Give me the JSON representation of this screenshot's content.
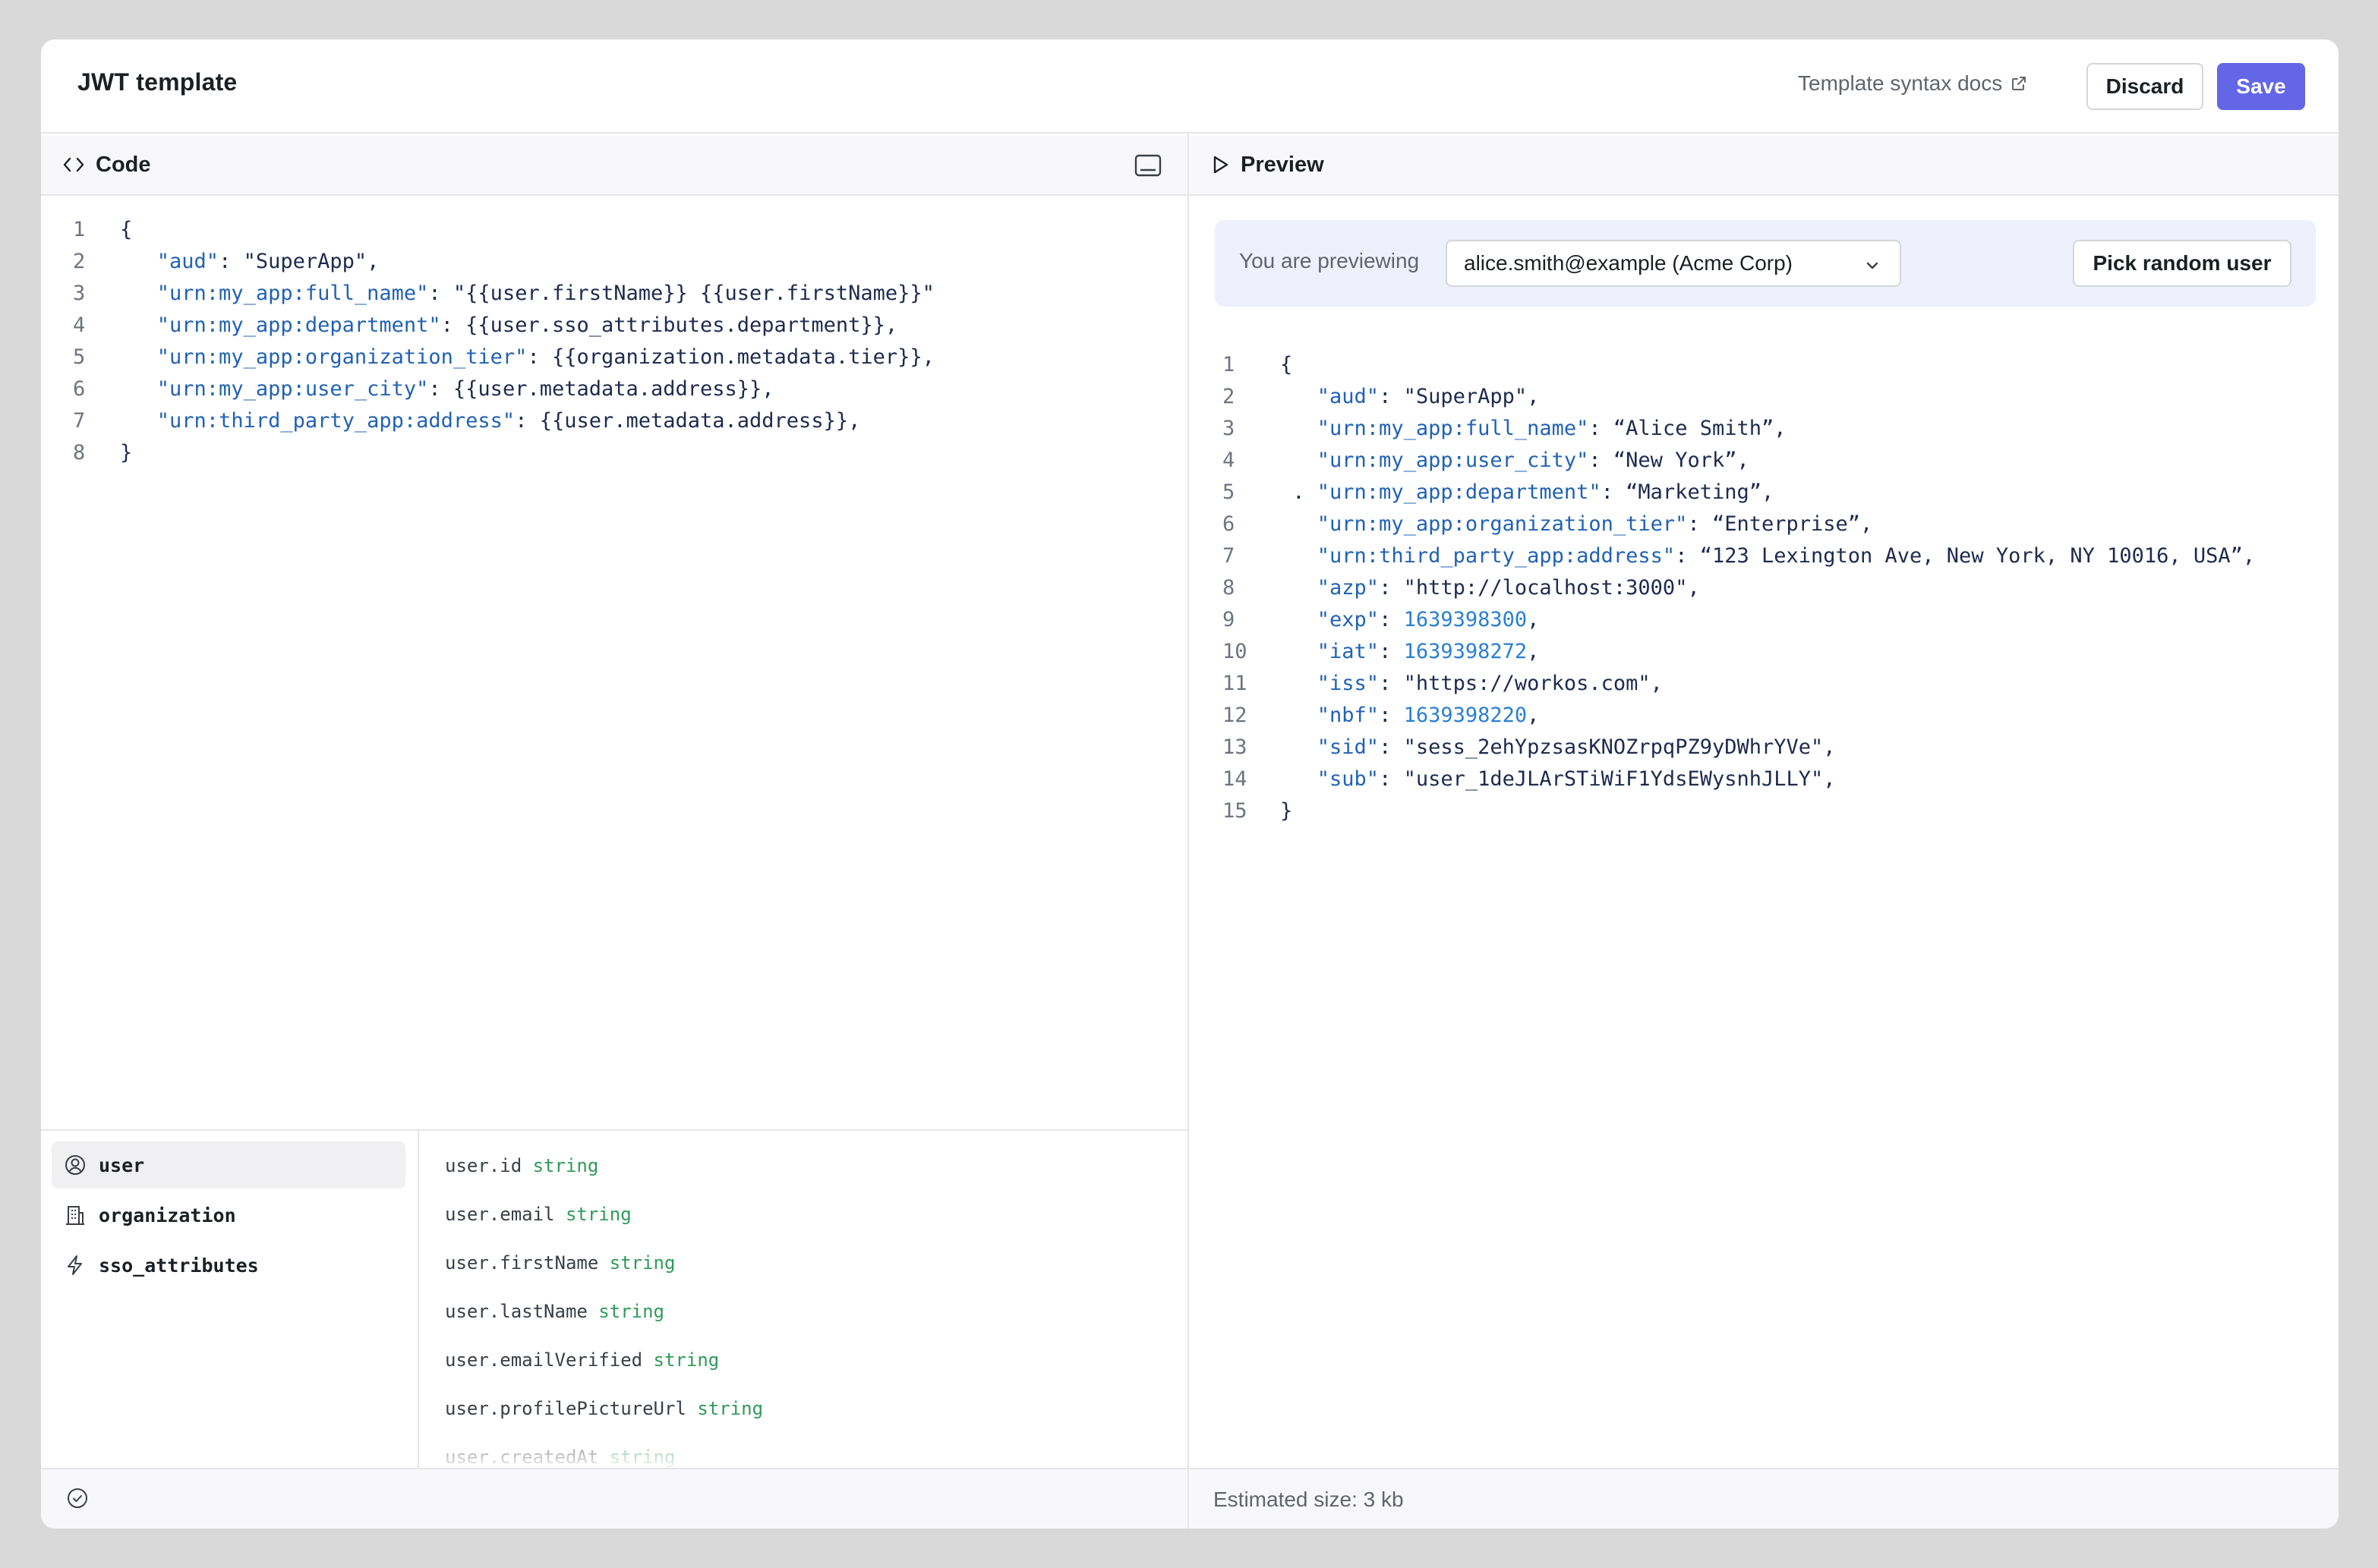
{
  "header": {
    "title": "JWT template",
    "docs_link": "Template syntax docs",
    "discard_label": "Discard",
    "save_label": "Save"
  },
  "code_pane": {
    "title": "Code",
    "lines": [
      {
        "num": "1",
        "parts": [
          {
            "t": "{",
            "c": "s"
          }
        ]
      },
      {
        "num": "2",
        "parts": [
          {
            "t": "   ",
            "c": "s"
          },
          {
            "t": "\"aud\"",
            "c": "k"
          },
          {
            "t": ": \"SuperApp\",",
            "c": "s"
          }
        ]
      },
      {
        "num": "3",
        "parts": [
          {
            "t": "   ",
            "c": "s"
          },
          {
            "t": "\"urn:my_app:full_name\"",
            "c": "k"
          },
          {
            "t": ": \"{{user.firstName}} {{user.firstName}}\"",
            "c": "s"
          }
        ]
      },
      {
        "num": "4",
        "parts": [
          {
            "t": "   ",
            "c": "s"
          },
          {
            "t": "\"urn:my_app:department\"",
            "c": "k"
          },
          {
            "t": ": {{user.sso_attributes.department}},",
            "c": "s"
          }
        ]
      },
      {
        "num": "5",
        "parts": [
          {
            "t": "   ",
            "c": "s"
          },
          {
            "t": "\"urn:my_app:organization_tier\"",
            "c": "k"
          },
          {
            "t": ": {{organization.metadata.tier}},",
            "c": "s"
          }
        ]
      },
      {
        "num": "6",
        "parts": [
          {
            "t": "   ",
            "c": "s"
          },
          {
            "t": "\"urn:my_app:user_city\"",
            "c": "k"
          },
          {
            "t": ": {{user.metadata.address}},",
            "c": "s"
          }
        ]
      },
      {
        "num": "7",
        "parts": [
          {
            "t": "   ",
            "c": "s"
          },
          {
            "t": "\"urn:third_party_app:address\"",
            "c": "k"
          },
          {
            "t": ": {{user.metadata.address}},",
            "c": "s"
          }
        ]
      },
      {
        "num": "8",
        "parts": [
          {
            "t": "}",
            "c": "s"
          }
        ]
      }
    ]
  },
  "variables": {
    "categories": [
      {
        "label": "user",
        "icon": "user-circle-icon",
        "active": true
      },
      {
        "label": "organization",
        "icon": "building-icon",
        "active": false
      },
      {
        "label": "sso_attributes",
        "icon": "lightning-icon",
        "active": false
      }
    ],
    "fields": [
      {
        "name": "user.id",
        "type": "string"
      },
      {
        "name": "user.email",
        "type": "string"
      },
      {
        "name": "user.firstName",
        "type": "string"
      },
      {
        "name": "user.lastName",
        "type": "string"
      },
      {
        "name": "user.emailVerified",
        "type": "string"
      },
      {
        "name": "user.profilePictureUrl",
        "type": "string"
      },
      {
        "name": "user.createdAt",
        "type": "string"
      }
    ]
  },
  "preview_pane": {
    "title": "Preview",
    "previewing_label": "You are previewing",
    "selected_user": "alice.smith@example (Acme Corp)",
    "pick_random_label": "Pick random user",
    "estimated_size": "Estimated size: 3 kb",
    "lines": [
      {
        "num": "1",
        "parts": [
          {
            "t": "{",
            "c": "s"
          }
        ]
      },
      {
        "num": "2",
        "parts": [
          {
            "t": "   ",
            "c": "s"
          },
          {
            "t": "\"aud\"",
            "c": "k"
          },
          {
            "t": ": \"SuperApp\",",
            "c": "s"
          }
        ]
      },
      {
        "num": "3",
        "parts": [
          {
            "t": "   ",
            "c": "s"
          },
          {
            "t": "\"urn:my_app:full_name\"",
            "c": "k"
          },
          {
            "t": ": “Alice Smith”,",
            "c": "s"
          }
        ]
      },
      {
        "num": "4",
        "parts": [
          {
            "t": "   ",
            "c": "s"
          },
          {
            "t": "\"urn:my_app:user_city\"",
            "c": "k"
          },
          {
            "t": ": “New York”,",
            "c": "s"
          }
        ]
      },
      {
        "num": "5",
        "parts": [
          {
            "t": " . ",
            "c": "s"
          },
          {
            "t": "\"urn:my_app:department\"",
            "c": "k"
          },
          {
            "t": ": “Marketing”,",
            "c": "s"
          }
        ]
      },
      {
        "num": "6",
        "parts": [
          {
            "t": "   ",
            "c": "s"
          },
          {
            "t": "\"urn:my_app:organization_tier\"",
            "c": "k"
          },
          {
            "t": ": “Enterprise”,",
            "c": "s"
          }
        ]
      },
      {
        "num": "7",
        "parts": [
          {
            "t": "   ",
            "c": "s"
          },
          {
            "t": "\"urn:third_party_app:address\"",
            "c": "k"
          },
          {
            "t": ": “123 Lexington Ave, New York, NY 10016, USA”,",
            "c": "s"
          }
        ]
      },
      {
        "num": "8",
        "parts": [
          {
            "t": "   ",
            "c": "s"
          },
          {
            "t": "\"azp\"",
            "c": "k"
          },
          {
            "t": ": \"http://localhost:3000\",",
            "c": "s"
          }
        ]
      },
      {
        "num": "9",
        "parts": [
          {
            "t": "   ",
            "c": "s"
          },
          {
            "t": "\"exp\"",
            "c": "k"
          },
          {
            "t": ": ",
            "c": "s"
          },
          {
            "t": "1639398300",
            "c": "n"
          },
          {
            "t": ",",
            "c": "s"
          }
        ]
      },
      {
        "num": "10",
        "parts": [
          {
            "t": "   ",
            "c": "s"
          },
          {
            "t": "\"iat\"",
            "c": "k"
          },
          {
            "t": ": ",
            "c": "s"
          },
          {
            "t": "1639398272",
            "c": "n"
          },
          {
            "t": ",",
            "c": "s"
          }
        ]
      },
      {
        "num": "11",
        "parts": [
          {
            "t": "   ",
            "c": "s"
          },
          {
            "t": "\"iss\"",
            "c": "k"
          },
          {
            "t": ": \"https://workos.com\",",
            "c": "s"
          }
        ]
      },
      {
        "num": "12",
        "parts": [
          {
            "t": "   ",
            "c": "s"
          },
          {
            "t": "\"nbf\"",
            "c": "k"
          },
          {
            "t": ": ",
            "c": "s"
          },
          {
            "t": "1639398220",
            "c": "n"
          },
          {
            "t": ",",
            "c": "s"
          }
        ]
      },
      {
        "num": "13",
        "parts": [
          {
            "t": "   ",
            "c": "s"
          },
          {
            "t": "\"sid\"",
            "c": "k"
          },
          {
            "t": ": \"sess_2ehYpzsasKNOZrpqPZ9yDWhrYVe\",",
            "c": "s"
          }
        ]
      },
      {
        "num": "14",
        "parts": [
          {
            "t": "   ",
            "c": "s"
          },
          {
            "t": "\"sub\"",
            "c": "k"
          },
          {
            "t": ": \"user_1deJLArSTiWiF1YdsEWysnhJLLY\",",
            "c": "s"
          }
        ]
      },
      {
        "num": "15",
        "parts": [
          {
            "t": "}",
            "c": "s"
          }
        ]
      }
    ]
  },
  "colors": {
    "accent": "#6366e6",
    "json_key": "#2162b5",
    "json_number": "#2a7fd4",
    "type_label": "#2f9a5a"
  }
}
